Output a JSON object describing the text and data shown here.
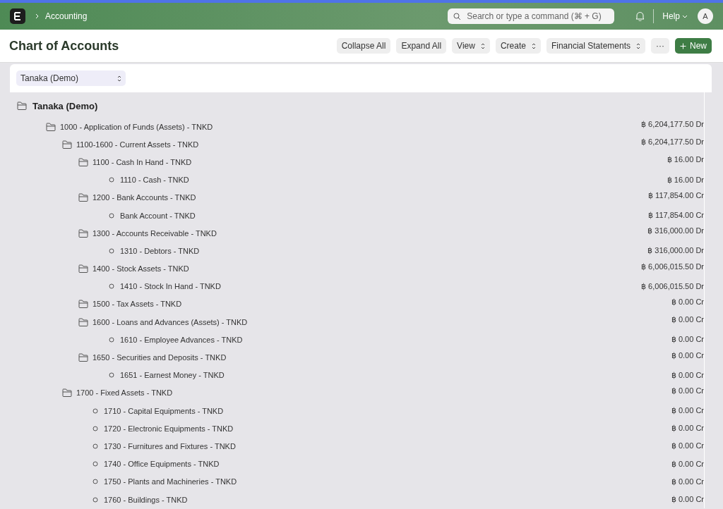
{
  "navbar": {
    "breadcrumb": "Accounting",
    "search": {
      "placeholder": "Search or type a command (⌘ + G)"
    },
    "help": "Help",
    "avatar": "A"
  },
  "page": {
    "title": "Chart of Accounts",
    "actions": [
      {
        "label": "Collapse All",
        "kind": "plain"
      },
      {
        "label": "Expand All",
        "kind": "plain"
      },
      {
        "label": "View",
        "kind": "dropdown"
      },
      {
        "label": "Create",
        "kind": "dropdown"
      },
      {
        "label": "Financial Statements",
        "kind": "dropdown"
      },
      {
        "label": "···",
        "kind": "plain"
      },
      {
        "label": "New",
        "kind": "primary"
      }
    ]
  },
  "filter": {
    "company": "Tanaka (Demo)"
  },
  "tree": {
    "label": "Tanaka (Demo)",
    "children": [
      {
        "label": "1000 - Application of Funds (Assets) - TNKD",
        "kind": "group",
        "balance": "฿ 6,204,177.50 Dr",
        "children": [
          {
            "label": "1100-1600 - Current Assets - TNKD",
            "kind": "group",
            "balance": "฿ 6,204,177.50 Dr",
            "children": [
              {
                "label": "1100 - Cash In Hand - TNKD",
                "kind": "group",
                "balance": "฿ 16.00 Dr",
                "children": [
                  {
                    "label": "1110 - Cash - TNKD",
                    "kind": "leaf",
                    "balance": "฿ 16.00 Dr"
                  }
                ]
              },
              {
                "label": "1200 - Bank Accounts - TNKD",
                "kind": "group",
                "balance": "฿ 117,854.00 Cr",
                "children": [
                  {
                    "label": "Bank Account - TNKD",
                    "kind": "leaf",
                    "balance": "฿ 117,854.00 Cr"
                  }
                ]
              },
              {
                "label": "1300 - Accounts Receivable - TNKD",
                "kind": "group",
                "balance": "฿ 316,000.00 Dr",
                "children": [
                  {
                    "label": "1310 - Debtors - TNKD",
                    "kind": "leaf",
                    "balance": "฿ 316,000.00 Dr"
                  }
                ]
              },
              {
                "label": "1400 - Stock Assets - TNKD",
                "kind": "group",
                "balance": "฿ 6,006,015.50 Dr",
                "children": [
                  {
                    "label": "1410 - Stock In Hand - TNKD",
                    "kind": "leaf",
                    "balance": "฿ 6,006,015.50 Dr"
                  }
                ]
              },
              {
                "label": "1500 - Tax Assets - TNKD",
                "kind": "group",
                "balance": "฿ 0.00 Cr"
              },
              {
                "label": "1600 - Loans and Advances (Assets) - TNKD",
                "kind": "group",
                "balance": "฿ 0.00 Cr",
                "children": [
                  {
                    "label": "1610 - Employee Advances - TNKD",
                    "kind": "leaf",
                    "balance": "฿ 0.00 Cr"
                  }
                ]
              },
              {
                "label": "1650 - Securities and Deposits - TNKD",
                "kind": "group",
                "balance": "฿ 0.00 Cr",
                "children": [
                  {
                    "label": "1651 - Earnest Money - TNKD",
                    "kind": "leaf",
                    "balance": "฿ 0.00 Cr"
                  }
                ]
              }
            ]
          },
          {
            "label": "1700 - Fixed Assets - TNKD",
            "kind": "group",
            "balance": "฿ 0.00 Cr",
            "children": [
              {
                "label": "1710 - Capital Equipments - TNKD",
                "kind": "leaf",
                "balance": "฿ 0.00 Cr"
              },
              {
                "label": "1720 - Electronic Equipments - TNKD",
                "kind": "leaf",
                "balance": "฿ 0.00 Cr"
              },
              {
                "label": "1730 - Furnitures and Fixtures - TNKD",
                "kind": "leaf",
                "balance": "฿ 0.00 Cr"
              },
              {
                "label": "1740 - Office Equipments - TNKD",
                "kind": "leaf",
                "balance": "฿ 0.00 Cr"
              },
              {
                "label": "1750 - Plants and Machineries - TNKD",
                "kind": "leaf",
                "balance": "฿ 0.00 Cr"
              },
              {
                "label": "1760 - Buildings - TNKD",
                "kind": "leaf",
                "balance": "฿ 0.00 Cr"
              }
            ]
          }
        ]
      }
    ]
  }
}
